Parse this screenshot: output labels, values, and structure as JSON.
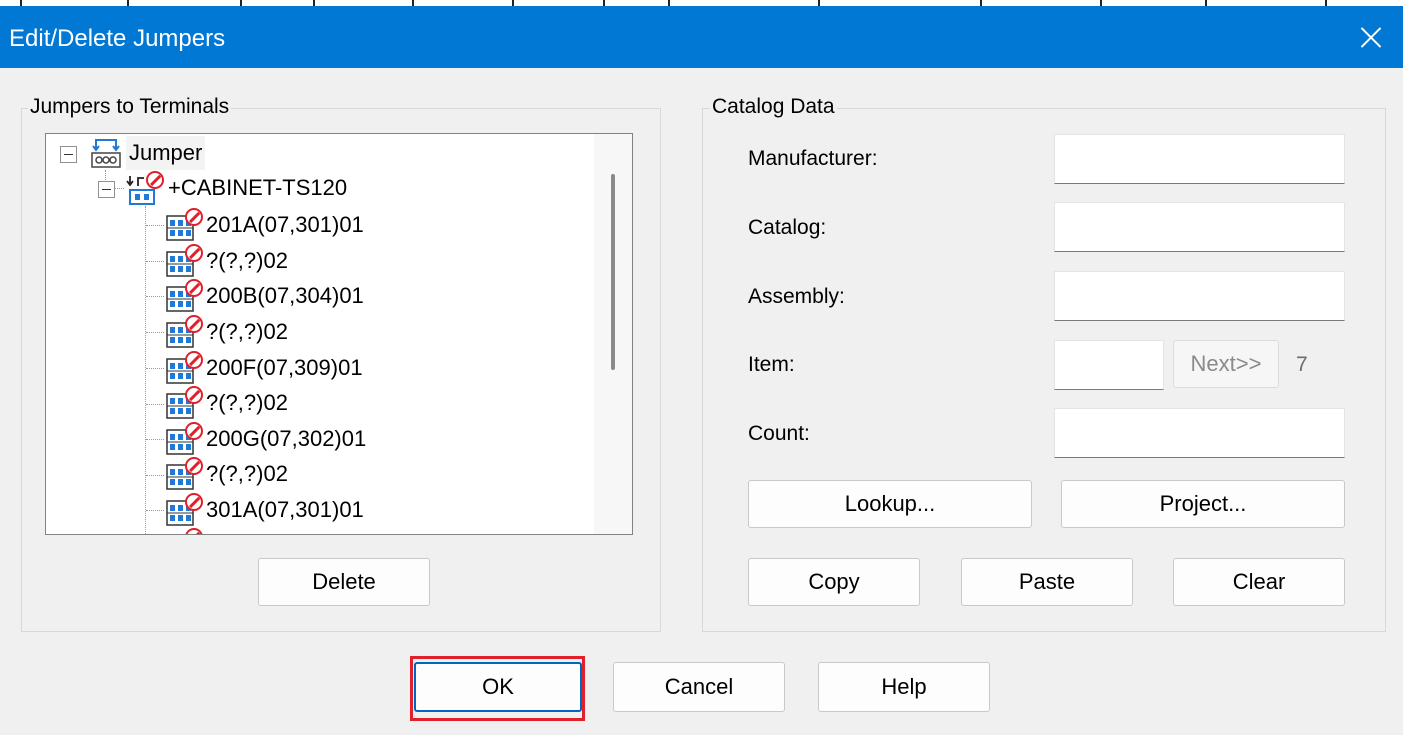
{
  "window": {
    "title": "Edit/Delete Jumpers"
  },
  "left_group": {
    "label": "Jumpers to Terminals",
    "tree": {
      "root": "Jumper",
      "child": "+CABINET-TS120",
      "items": [
        "201A(07,301)01",
        "?(?,?)02",
        "200B(07,304)01",
        "?(?,?)02",
        "200F(07,309)01",
        "?(?,?)02",
        "200G(07,302)01",
        "?(?,?)02",
        "301A(07,301)01"
      ]
    },
    "delete_label": "Delete"
  },
  "catalog": {
    "label": "Catalog Data",
    "manufacturer_label": "Manufacturer:",
    "manufacturer_value": "",
    "catalog_label": "Catalog:",
    "catalog_value": "",
    "assembly_label": "Assembly:",
    "assembly_value": "",
    "item_label": "Item:",
    "item_value": "",
    "next_label": "Next>>",
    "next_value": "7",
    "count_label": "Count:",
    "count_value": "",
    "lookup_label": "Lookup...",
    "project_label": "Project...",
    "copy_label": "Copy",
    "paste_label": "Paste",
    "clear_label": "Clear"
  },
  "footer": {
    "ok_label": "OK",
    "cancel_label": "Cancel",
    "help_label": "Help"
  },
  "colors": {
    "titlebar": "#0078d4",
    "highlight": "#e0202a",
    "badge": "#e0202a",
    "jumper_icon": "#1e7ad6"
  }
}
